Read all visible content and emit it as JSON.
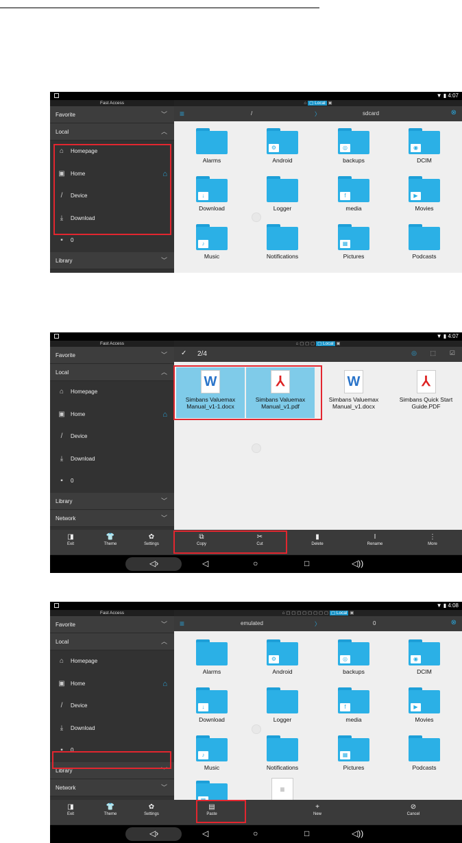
{
  "status": {
    "time1": "4:07",
    "time2": "4:07",
    "time3": "4:08"
  },
  "sidebar": {
    "header": "Fast Access",
    "favorite": "Favorite",
    "local": "Local",
    "items": [
      {
        "label": "Homepage"
      },
      {
        "label": "Home"
      },
      {
        "label": "Device"
      },
      {
        "label": "Download"
      },
      {
        "label": "0"
      }
    ],
    "library": "Library",
    "network": "Network"
  },
  "screen1": {
    "path_root": "/",
    "path_current": "sdcard",
    "folders": [
      "Alarms",
      "Android",
      "backups",
      "DCIM",
      "Download",
      "Logger",
      "media",
      "Movies",
      "Music",
      "Notifications",
      "Pictures",
      "Podcasts"
    ]
  },
  "screen2": {
    "selection_count": "2/4",
    "files": [
      {
        "name": "Simbans Valuemax Manual_v1-1.docx",
        "icon": "W"
      },
      {
        "name": "Simbans Valuemax Manual_v1.pdf",
        "icon": "pdf"
      },
      {
        "name": "Simbans Valuemax Manual_v1.docx",
        "icon": "W"
      },
      {
        "name": "Simbans Quick Start Guide.PDF",
        "icon": "pdf"
      }
    ],
    "side_buttons": [
      "Exit",
      "Theme",
      "Settings"
    ],
    "actions": [
      "Copy",
      "Cut",
      "Delete",
      "Rename",
      "More"
    ]
  },
  "screen3": {
    "path_parent": "emulated",
    "path_current": "0",
    "side_buttons": [
      "Exit",
      "Theme",
      "Settings"
    ],
    "actions": [
      "Paste",
      "New",
      "Cancel"
    ]
  }
}
